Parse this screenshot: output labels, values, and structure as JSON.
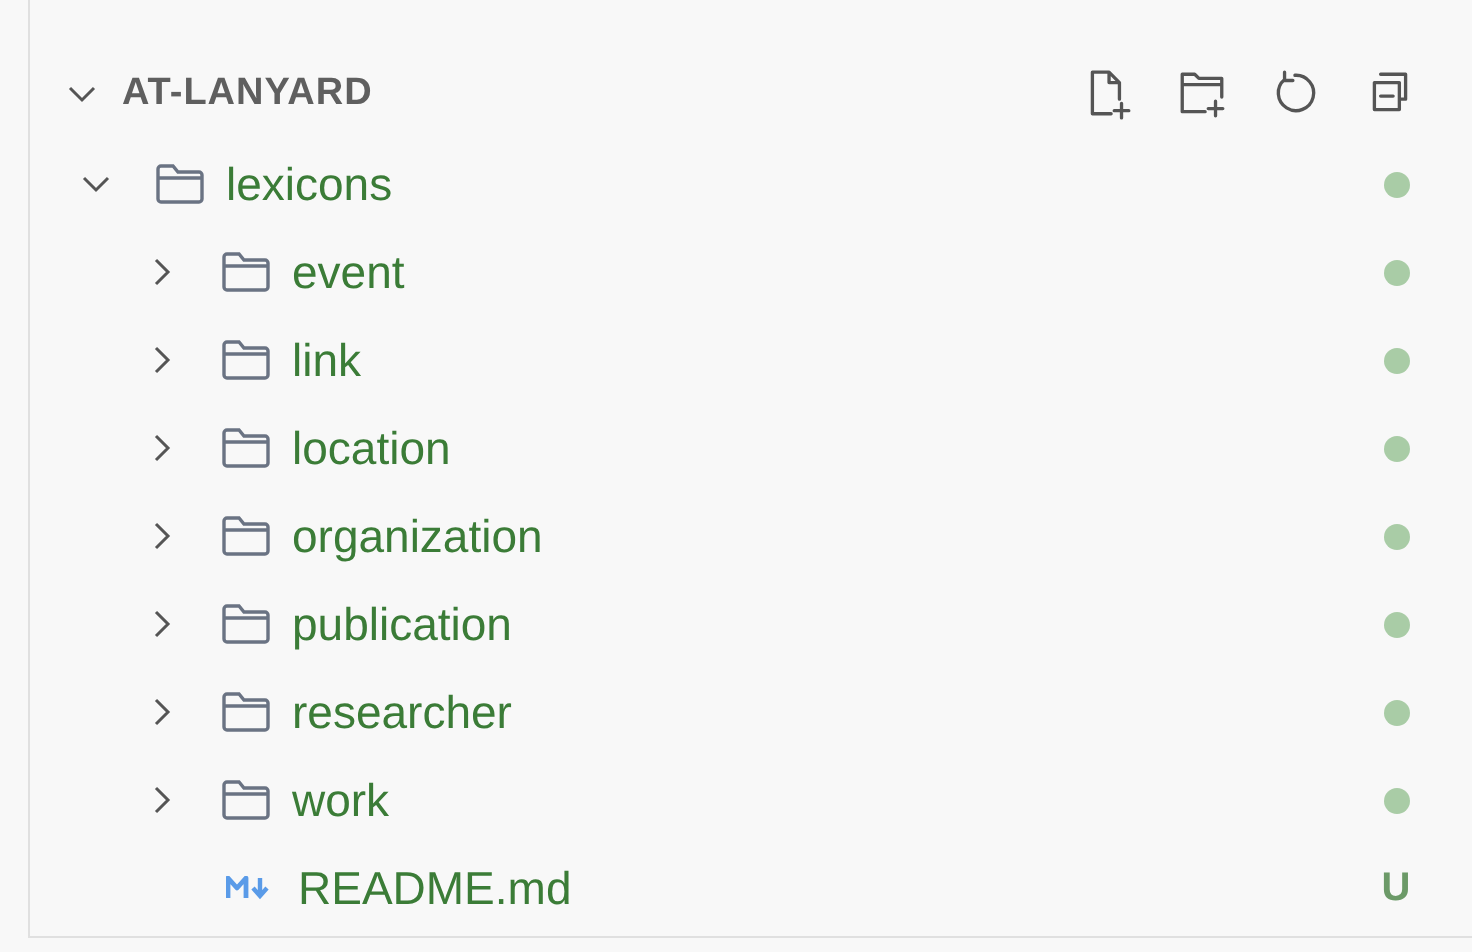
{
  "section": {
    "title": "AT-LANYARD",
    "expanded": true,
    "actions": [
      {
        "kind": "new-file"
      },
      {
        "kind": "new-folder"
      },
      {
        "kind": "refresh"
      },
      {
        "kind": "collapse-all"
      }
    ]
  },
  "tree": [
    {
      "kind": "folder",
      "label": "lexicons",
      "expanded": true,
      "changed": true,
      "children": [
        {
          "kind": "folder",
          "label": "event",
          "expanded": false,
          "changed": true
        },
        {
          "kind": "folder",
          "label": "link",
          "expanded": false,
          "changed": true
        },
        {
          "kind": "folder",
          "label": "location",
          "expanded": false,
          "changed": true
        },
        {
          "kind": "folder",
          "label": "organization",
          "expanded": false,
          "changed": true
        },
        {
          "kind": "folder",
          "label": "publication",
          "expanded": false,
          "changed": true
        },
        {
          "kind": "folder",
          "label": "researcher",
          "expanded": false,
          "changed": true
        },
        {
          "kind": "folder",
          "label": "work",
          "expanded": false,
          "changed": true
        },
        {
          "kind": "markdown",
          "label": "README.md",
          "status": "U"
        }
      ]
    }
  ]
}
